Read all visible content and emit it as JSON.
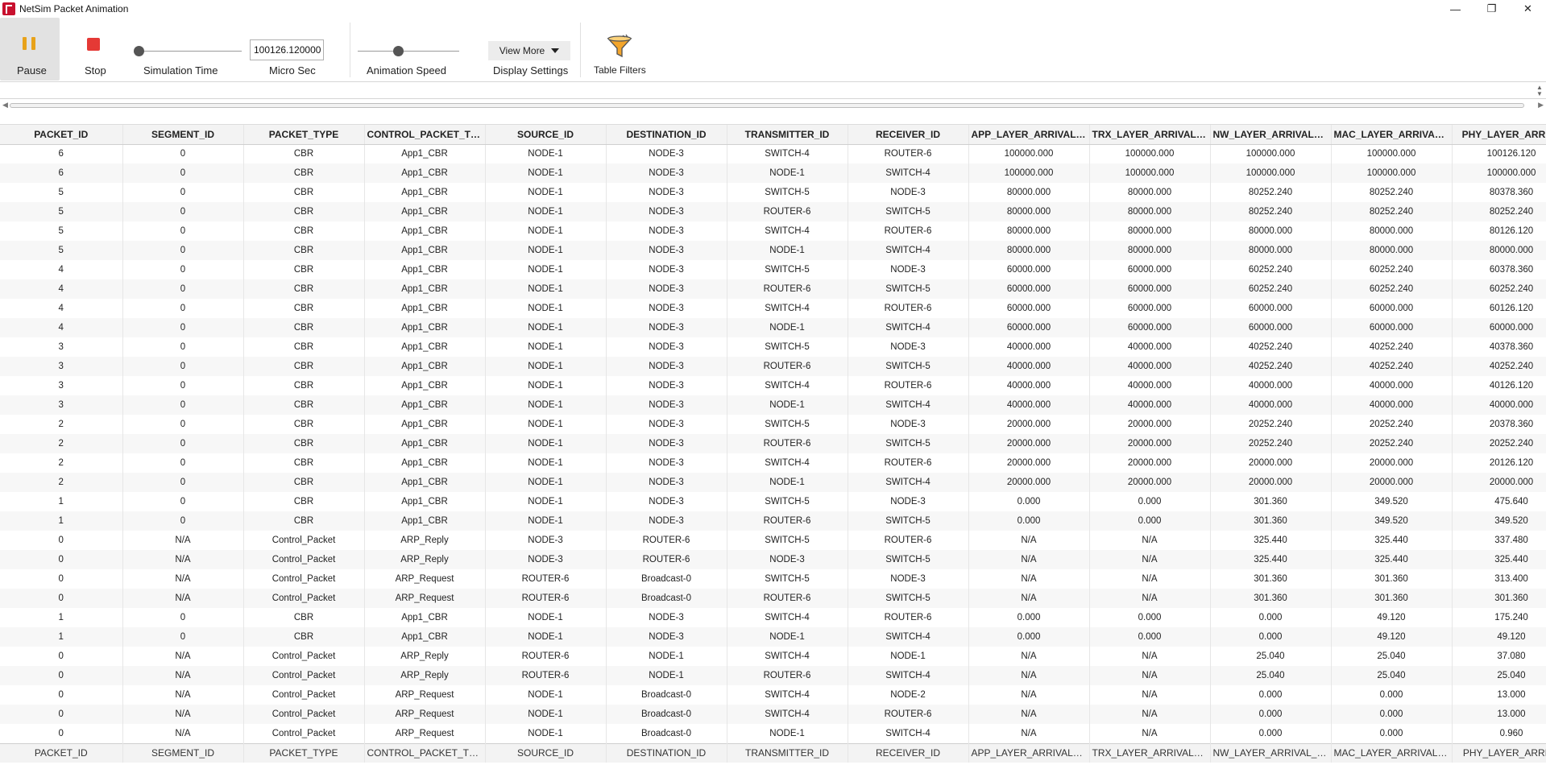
{
  "window": {
    "title": "NetSim Packet Animation",
    "controls": [
      "—",
      "❐",
      "✕"
    ]
  },
  "toolbar": {
    "pause_label": "Pause",
    "stop_label": "Stop",
    "simulation_time_label": "Simulation Time",
    "time_value": "100126.120000",
    "time_unit_label": "Micro Sec",
    "animation_speed_label": "Animation Speed",
    "animation_speed_level": 0.4,
    "simulation_time_level": 0.0,
    "view_more_label": "View More",
    "display_settings_label": "Display Settings",
    "table_filters_label": "Table Filters"
  },
  "colors": {
    "pause_icon": "#e8a21a",
    "stop_icon": "#e53935",
    "pause_bg": "#e2e2e2"
  },
  "table": {
    "columns": [
      "PACKET_ID",
      "SEGMENT_ID",
      "PACKET_TYPE",
      "CONTROL_PACKET_TYP...",
      "SOURCE_ID",
      "DESTINATION_ID",
      "TRANSMITTER_ID",
      "RECEIVER_ID",
      "APP_LAYER_ARRIVAL_T...",
      "TRX_LAYER_ARRIVAL_T...",
      "NW_LAYER_ARRIVAL_TI...",
      "MAC_LAYER_ARRIVAL_...",
      "PHY_LAYER_ARRIVA"
    ],
    "footer": [
      "PACKET_ID",
      "SEGMENT_ID",
      "PACKET_TYPE",
      "CONTROL_PACKET_TYPE...",
      "SOURCE_ID",
      "DESTINATION_ID",
      "TRANSMITTER_ID",
      "RECEIVER_ID",
      "APP_LAYER_ARRIVAL_TI...",
      "TRX_LAYER_ARRIVAL_TI...",
      "NW_LAYER_ARRIVAL_TI...",
      "MAC_LAYER_ARRIVAL_TI...",
      "PHY_LAYER_ARRIVA"
    ],
    "rows": [
      [
        "6",
        "0",
        "CBR",
        "App1_CBR",
        "NODE-1",
        "NODE-3",
        "SWITCH-4",
        "ROUTER-6",
        "100000.000",
        "100000.000",
        "100000.000",
        "100000.000",
        "100126.120"
      ],
      [
        "6",
        "0",
        "CBR",
        "App1_CBR",
        "NODE-1",
        "NODE-3",
        "NODE-1",
        "SWITCH-4",
        "100000.000",
        "100000.000",
        "100000.000",
        "100000.000",
        "100000.000"
      ],
      [
        "5",
        "0",
        "CBR",
        "App1_CBR",
        "NODE-1",
        "NODE-3",
        "SWITCH-5",
        "NODE-3",
        "80000.000",
        "80000.000",
        "80252.240",
        "80252.240",
        "80378.360"
      ],
      [
        "5",
        "0",
        "CBR",
        "App1_CBR",
        "NODE-1",
        "NODE-3",
        "ROUTER-6",
        "SWITCH-5",
        "80000.000",
        "80000.000",
        "80252.240",
        "80252.240",
        "80252.240"
      ],
      [
        "5",
        "0",
        "CBR",
        "App1_CBR",
        "NODE-1",
        "NODE-3",
        "SWITCH-4",
        "ROUTER-6",
        "80000.000",
        "80000.000",
        "80000.000",
        "80000.000",
        "80126.120"
      ],
      [
        "5",
        "0",
        "CBR",
        "App1_CBR",
        "NODE-1",
        "NODE-3",
        "NODE-1",
        "SWITCH-4",
        "80000.000",
        "80000.000",
        "80000.000",
        "80000.000",
        "80000.000"
      ],
      [
        "4",
        "0",
        "CBR",
        "App1_CBR",
        "NODE-1",
        "NODE-3",
        "SWITCH-5",
        "NODE-3",
        "60000.000",
        "60000.000",
        "60252.240",
        "60252.240",
        "60378.360"
      ],
      [
        "4",
        "0",
        "CBR",
        "App1_CBR",
        "NODE-1",
        "NODE-3",
        "ROUTER-6",
        "SWITCH-5",
        "60000.000",
        "60000.000",
        "60252.240",
        "60252.240",
        "60252.240"
      ],
      [
        "4",
        "0",
        "CBR",
        "App1_CBR",
        "NODE-1",
        "NODE-3",
        "SWITCH-4",
        "ROUTER-6",
        "60000.000",
        "60000.000",
        "60000.000",
        "60000.000",
        "60126.120"
      ],
      [
        "4",
        "0",
        "CBR",
        "App1_CBR",
        "NODE-1",
        "NODE-3",
        "NODE-1",
        "SWITCH-4",
        "60000.000",
        "60000.000",
        "60000.000",
        "60000.000",
        "60000.000"
      ],
      [
        "3",
        "0",
        "CBR",
        "App1_CBR",
        "NODE-1",
        "NODE-3",
        "SWITCH-5",
        "NODE-3",
        "40000.000",
        "40000.000",
        "40252.240",
        "40252.240",
        "40378.360"
      ],
      [
        "3",
        "0",
        "CBR",
        "App1_CBR",
        "NODE-1",
        "NODE-3",
        "ROUTER-6",
        "SWITCH-5",
        "40000.000",
        "40000.000",
        "40252.240",
        "40252.240",
        "40252.240"
      ],
      [
        "3",
        "0",
        "CBR",
        "App1_CBR",
        "NODE-1",
        "NODE-3",
        "SWITCH-4",
        "ROUTER-6",
        "40000.000",
        "40000.000",
        "40000.000",
        "40000.000",
        "40126.120"
      ],
      [
        "3",
        "0",
        "CBR",
        "App1_CBR",
        "NODE-1",
        "NODE-3",
        "NODE-1",
        "SWITCH-4",
        "40000.000",
        "40000.000",
        "40000.000",
        "40000.000",
        "40000.000"
      ],
      [
        "2",
        "0",
        "CBR",
        "App1_CBR",
        "NODE-1",
        "NODE-3",
        "SWITCH-5",
        "NODE-3",
        "20000.000",
        "20000.000",
        "20252.240",
        "20252.240",
        "20378.360"
      ],
      [
        "2",
        "0",
        "CBR",
        "App1_CBR",
        "NODE-1",
        "NODE-3",
        "ROUTER-6",
        "SWITCH-5",
        "20000.000",
        "20000.000",
        "20252.240",
        "20252.240",
        "20252.240"
      ],
      [
        "2",
        "0",
        "CBR",
        "App1_CBR",
        "NODE-1",
        "NODE-3",
        "SWITCH-4",
        "ROUTER-6",
        "20000.000",
        "20000.000",
        "20000.000",
        "20000.000",
        "20126.120"
      ],
      [
        "2",
        "0",
        "CBR",
        "App1_CBR",
        "NODE-1",
        "NODE-3",
        "NODE-1",
        "SWITCH-4",
        "20000.000",
        "20000.000",
        "20000.000",
        "20000.000",
        "20000.000"
      ],
      [
        "1",
        "0",
        "CBR",
        "App1_CBR",
        "NODE-1",
        "NODE-3",
        "SWITCH-5",
        "NODE-3",
        "0.000",
        "0.000",
        "301.360",
        "349.520",
        "475.640"
      ],
      [
        "1",
        "0",
        "CBR",
        "App1_CBR",
        "NODE-1",
        "NODE-3",
        "ROUTER-6",
        "SWITCH-5",
        "0.000",
        "0.000",
        "301.360",
        "349.520",
        "349.520"
      ],
      [
        "0",
        "N/A",
        "Control_Packet",
        "ARP_Reply",
        "NODE-3",
        "ROUTER-6",
        "SWITCH-5",
        "ROUTER-6",
        "N/A",
        "N/A",
        "325.440",
        "325.440",
        "337.480"
      ],
      [
        "0",
        "N/A",
        "Control_Packet",
        "ARP_Reply",
        "NODE-3",
        "ROUTER-6",
        "NODE-3",
        "SWITCH-5",
        "N/A",
        "N/A",
        "325.440",
        "325.440",
        "325.440"
      ],
      [
        "0",
        "N/A",
        "Control_Packet",
        "ARP_Request",
        "ROUTER-6",
        "Broadcast-0",
        "SWITCH-5",
        "NODE-3",
        "N/A",
        "N/A",
        "301.360",
        "301.360",
        "313.400"
      ],
      [
        "0",
        "N/A",
        "Control_Packet",
        "ARP_Request",
        "ROUTER-6",
        "Broadcast-0",
        "ROUTER-6",
        "SWITCH-5",
        "N/A",
        "N/A",
        "301.360",
        "301.360",
        "301.360"
      ],
      [
        "1",
        "0",
        "CBR",
        "App1_CBR",
        "NODE-1",
        "NODE-3",
        "SWITCH-4",
        "ROUTER-6",
        "0.000",
        "0.000",
        "0.000",
        "49.120",
        "175.240"
      ],
      [
        "1",
        "0",
        "CBR",
        "App1_CBR",
        "NODE-1",
        "NODE-3",
        "NODE-1",
        "SWITCH-4",
        "0.000",
        "0.000",
        "0.000",
        "49.120",
        "49.120"
      ],
      [
        "0",
        "N/A",
        "Control_Packet",
        "ARP_Reply",
        "ROUTER-6",
        "NODE-1",
        "SWITCH-4",
        "NODE-1",
        "N/A",
        "N/A",
        "25.040",
        "25.040",
        "37.080"
      ],
      [
        "0",
        "N/A",
        "Control_Packet",
        "ARP_Reply",
        "ROUTER-6",
        "NODE-1",
        "ROUTER-6",
        "SWITCH-4",
        "N/A",
        "N/A",
        "25.040",
        "25.040",
        "25.040"
      ],
      [
        "0",
        "N/A",
        "Control_Packet",
        "ARP_Request",
        "NODE-1",
        "Broadcast-0",
        "SWITCH-4",
        "NODE-2",
        "N/A",
        "N/A",
        "0.000",
        "0.000",
        "13.000"
      ],
      [
        "0",
        "N/A",
        "Control_Packet",
        "ARP_Request",
        "NODE-1",
        "Broadcast-0",
        "SWITCH-4",
        "ROUTER-6",
        "N/A",
        "N/A",
        "0.000",
        "0.000",
        "13.000"
      ],
      [
        "0",
        "N/A",
        "Control_Packet",
        "ARP_Request",
        "NODE-1",
        "Broadcast-0",
        "NODE-1",
        "SWITCH-4",
        "N/A",
        "N/A",
        "0.000",
        "0.000",
        "0.960"
      ]
    ]
  }
}
